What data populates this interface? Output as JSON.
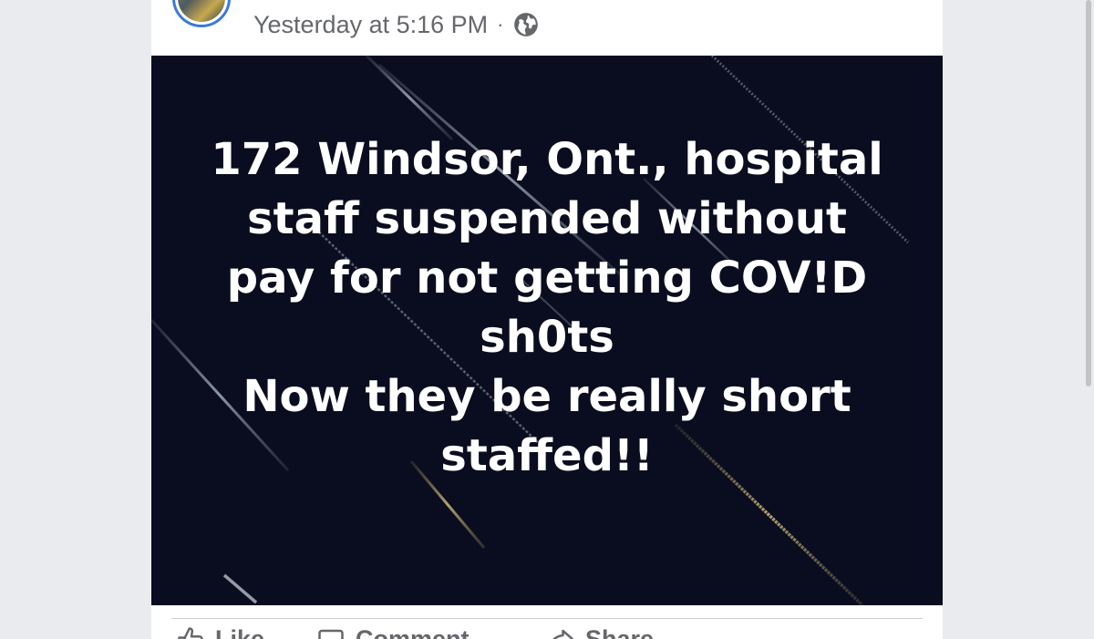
{
  "post": {
    "author_name_visible": "",
    "timestamp": "Yesterday at 5:16 PM",
    "separator": "·",
    "privacy_icon": "globe-icon"
  },
  "image": {
    "background_color": "#0a0d1f",
    "text_color": "#ffffff",
    "lines": [
      "172 Windsor, Ont., hospital",
      "staff suspended without",
      "pay for not getting COV!D",
      "sh0ts",
      "Now they be really short",
      "staffed!!"
    ]
  },
  "actions": {
    "like_label": "Like",
    "comment_label": "Comment",
    "share_label": "Share",
    "like_icon": "thumbs-up-icon",
    "comment_icon": "comment-icon",
    "share_icon": "share-icon"
  },
  "colors": {
    "page_background": "#e9ebee",
    "card_background": "#ffffff",
    "meta_text": "#65676b",
    "avatar_ring": "#3b7ad8"
  }
}
